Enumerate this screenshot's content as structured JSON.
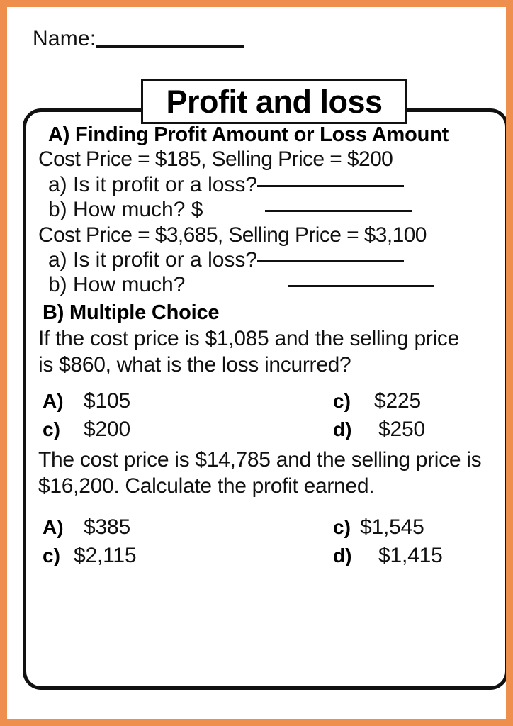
{
  "worksheet": {
    "name_label": "Name:",
    "title": "Profit and loss",
    "section_a": {
      "heading": "A) Finding Profit Amount or Loss Amount",
      "problems": [
        {
          "prompt": "Cost Price = $185, Selling Price = $200",
          "sub_a": "a) Is it profit or a loss?",
          "sub_b": "b) How much? $"
        },
        {
          "prompt": "Cost Price = $3,685, Selling Price = $3,100",
          "sub_a": "a) Is it profit or a loss?",
          "sub_b": "b) How much?"
        }
      ]
    },
    "section_b": {
      "heading": "B) Multiple Choice",
      "questions": [
        {
          "text_line1": "If the cost price is $1,085 and the selling price",
          "text_line2": "is $860, what is the loss incurred?",
          "options": [
            {
              "label": "A)",
              "value": "$105"
            },
            {
              "label": "c)",
              "value": "$225"
            },
            {
              "label": "c)",
              "value": "$200"
            },
            {
              "label": "d)",
              "value": "$250"
            }
          ]
        },
        {
          "text_line1": "The cost price is $14,785 and the selling price is",
          "text_line2": "$16,200. Calculate the profit earned.",
          "options": [
            {
              "label": "A)",
              "value": "$385"
            },
            {
              "label": "c)",
              "value": "$1,545"
            },
            {
              "label": "c)",
              "value": "$2,115"
            },
            {
              "label": "d)",
              "value": "$1,415"
            }
          ]
        }
      ]
    },
    "colors": {
      "border_orange": "#ef8f4d",
      "ink_black": "#111111",
      "paper_white": "#ffffff"
    }
  }
}
